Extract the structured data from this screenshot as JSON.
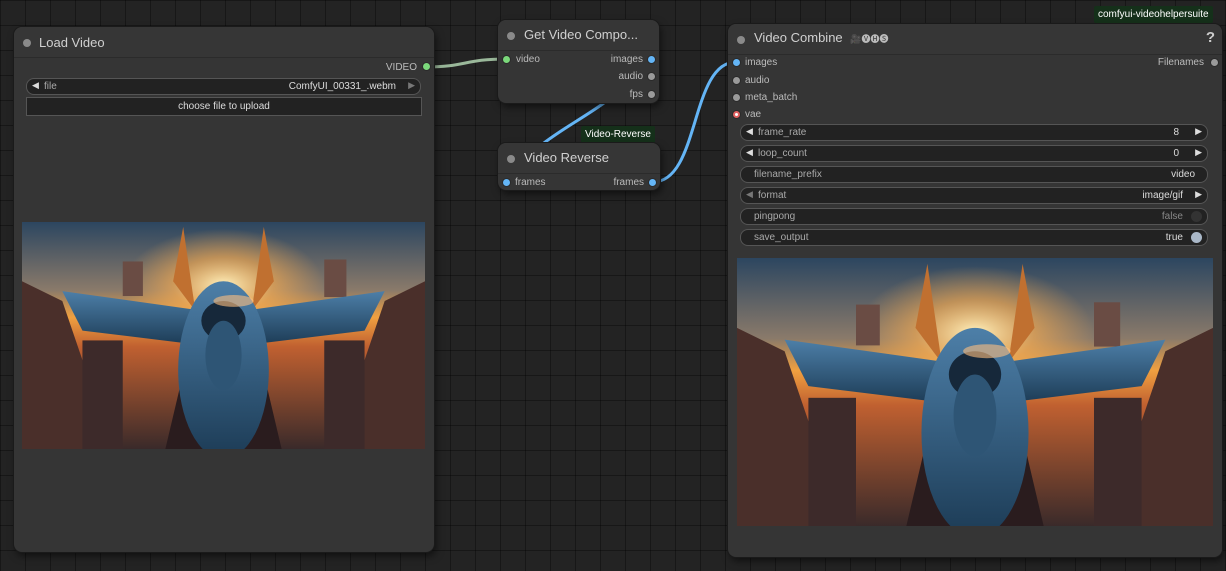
{
  "nodes": {
    "load_video": {
      "title": "Load Video",
      "output_label": "VIDEO",
      "file_widget": {
        "label": "file",
        "value": "ComfyUI_00331_.webm"
      },
      "upload_button": "choose file to upload"
    },
    "get_components": {
      "title": "Get Video Compo...",
      "input_label": "video",
      "outputs": [
        "images",
        "audio",
        "fps"
      ]
    },
    "video_reverse": {
      "title": "Video Reverse",
      "input_label": "frames",
      "output_label": "frames",
      "badge": "Video-Reverse"
    },
    "video_combine": {
      "title": "Video Combine",
      "title_badges": "🎥🅥🅗🅢",
      "help_icon": "?",
      "inputs": [
        "images",
        "audio",
        "meta_batch",
        "vae"
      ],
      "output_label": "Filenames",
      "badge": "comfyui-videohelpersuite",
      "widgets": {
        "frame_rate": {
          "label": "frame_rate",
          "value": "8"
        },
        "loop_count": {
          "label": "loop_count",
          "value": "0"
        },
        "filename_prefix": {
          "label": "filename_prefix",
          "value": "video"
        },
        "format": {
          "label": "format",
          "value": "image/gif"
        },
        "pingpong": {
          "label": "pingpong",
          "value": "false"
        },
        "save_output": {
          "label": "save_output",
          "value": "true"
        }
      }
    }
  },
  "icons": {
    "arrow_left": "◀",
    "arrow_right": "▶",
    "plane_preview": "fighter-jet-over-city-at-sunset"
  },
  "colors": {
    "canvas": "#232323",
    "node_bg": "#353535",
    "link_video": "#7bd87b",
    "link_image": "#64b5f6",
    "badge_bg": "#15301a"
  }
}
